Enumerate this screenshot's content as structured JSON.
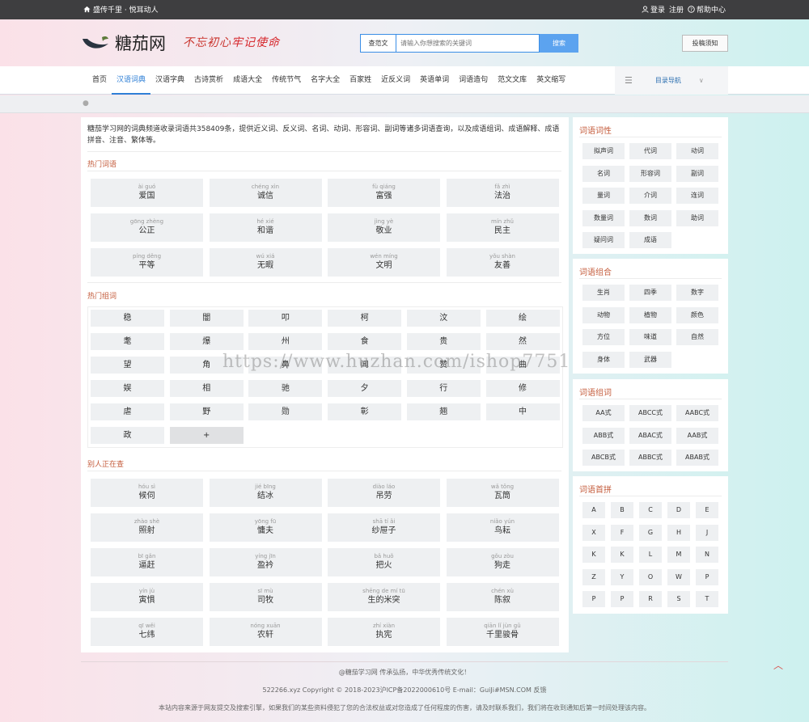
{
  "topbar": {
    "left_text": "盛传千里 · 悦耳动人",
    "login": "登录",
    "register": "注册",
    "help": "帮助中心"
  },
  "header": {
    "logo_text": "糖茄网",
    "slogan_part1": "不忘初心",
    "slogan_part2": "牢记使命",
    "search_category": "查范文",
    "search_placeholder": "请输入你想搜索的关键词",
    "search_button": "搜索",
    "contribute": "投稿须知"
  },
  "nav": {
    "items": [
      "首页",
      "汉语词典",
      "汉语字典",
      "古诗赏析",
      "成语大全",
      "传统节气",
      "名字大全",
      "百家姓",
      "近反义词",
      "英语单词",
      "词语造句",
      "范文文库",
      "英文缩写"
    ],
    "active_index": 1,
    "directory": "目录导航"
  },
  "main": {
    "intro": "糖茄学习网的词典频道收录词语共358409条，提供近义词、反义词、名词、动词、形容词、副词等诸多词语查询，以及成语组词、成语解释、成语拼音、注音、繁体等。",
    "hot_words_title": "热门词语",
    "hot_words": [
      {
        "py": "ài guó",
        "w": "爱国"
      },
      {
        "py": "chéng xìn",
        "w": "诚信"
      },
      {
        "py": "fù qiáng",
        "w": "富强"
      },
      {
        "py": "fǎ zhì",
        "w": "法治"
      },
      {
        "py": "gōng zhèng",
        "w": "公正"
      },
      {
        "py": "hé xié",
        "w": "和谐"
      },
      {
        "py": "jìng yè",
        "w": "敬业"
      },
      {
        "py": "mín zhǔ",
        "w": "民主"
      },
      {
        "py": "píng děng",
        "w": "平等"
      },
      {
        "py": "wú xiá",
        "w": "无暇"
      },
      {
        "py": "wén míng",
        "w": "文明"
      },
      {
        "py": "yǒu shàn",
        "w": "友善"
      }
    ],
    "hot_chars_title": "热门组词",
    "hot_chars": [
      "稳",
      "闇",
      "叩",
      "柯",
      "汶",
      "绘",
      "耄",
      "爆",
      "州",
      "食",
      "贵",
      "然",
      "望",
      "角",
      "鼻",
      "闻",
      "赞",
      "曲",
      "娱",
      "相",
      "驰",
      "夕",
      "行",
      "修",
      "虐",
      "野",
      "勋",
      "彰",
      "翘",
      "中",
      "政",
      "+"
    ],
    "recent_title": "别人正在查",
    "recent_words": [
      {
        "py": "hóu sì",
        "w": "候伺"
      },
      {
        "py": "jié bīng",
        "w": "结冰"
      },
      {
        "py": "diào láo",
        "w": "吊劳"
      },
      {
        "py": "wǎ tǒng",
        "w": "瓦筒"
      },
      {
        "py": "zhào shè",
        "w": "照射"
      },
      {
        "py": "yōng fū",
        "w": "慵夫"
      },
      {
        "py": "shā tí ǎi",
        "w": "纱屉子"
      },
      {
        "py": "niǎo yún",
        "w": "鸟耘"
      },
      {
        "py": "bī gǎn",
        "w": "逼赶"
      },
      {
        "py": "yíng jīn",
        "w": "盈衿"
      },
      {
        "py": "bǎ huǒ",
        "w": "把火"
      },
      {
        "py": "gǒu zòu",
        "w": "狗走"
      },
      {
        "py": "yín jù",
        "w": "寅惧"
      },
      {
        "py": "sī mù",
        "w": "司牧"
      },
      {
        "py": "shēng de mí tū",
        "w": "生的米突"
      },
      {
        "py": "chén xù",
        "w": "陈叙"
      },
      {
        "py": "qī wěi",
        "w": "七纬"
      },
      {
        "py": "nóng xuān",
        "w": "农轩"
      },
      {
        "py": "zhí xiàn",
        "w": "执宪"
      },
      {
        "py": "qiān lǐ jùn gǔ",
        "w": "千里骏骨"
      }
    ]
  },
  "side": {
    "pos_title": "词语词性",
    "pos": [
      "拟声词",
      "代词",
      "动词",
      "名词",
      "形容词",
      "副词",
      "量词",
      "介词",
      "连词",
      "数量词",
      "数词",
      "助词",
      "疑问词",
      "成语"
    ],
    "combo_title": "词语组合",
    "combo": [
      "生肖",
      "四季",
      "数字",
      "动物",
      "植物",
      "颜色",
      "方位",
      "味道",
      "自然",
      "身体",
      "武器"
    ],
    "group_title": "词语组词",
    "group": [
      "AA式",
      "ABCC式",
      "AABC式",
      "ABB式",
      "ABAC式",
      "AAB式",
      "ABCB式",
      "ABBC式",
      "ABAB式"
    ],
    "initial_title": "词语首拼",
    "initials": [
      "A",
      "B",
      "C",
      "D",
      "E",
      "X",
      "F",
      "G",
      "H",
      "J",
      "K",
      "K",
      "L",
      "M",
      "N",
      "Z",
      "Y",
      "O",
      "W",
      "P",
      "P",
      "P",
      "R",
      "S",
      "T"
    ]
  },
  "footer": {
    "line1": "@糖茄学习网 传承弘扬，中华优秀传统文化！",
    "line2": "522266.xyz Copyright © 2018-2023沪ICP备2022000610号 E-mail：GuiJi#MSN.COM 反馈",
    "line3": "本站内容来源于网友提交及搜索引擎，如果我们的某些资料侵犯了您的合法权益或对您造成了任何程度的伤害，请及时联系我们，我们将在收到通知后第一时间处理该内容。"
  },
  "watermark": "https://www.huzhan.com/ishop7751",
  "colors": {
    "accent_blue": "#2e7fd6",
    "section_title": "#c45c3c",
    "topbar_bg": "#3e3e40"
  }
}
